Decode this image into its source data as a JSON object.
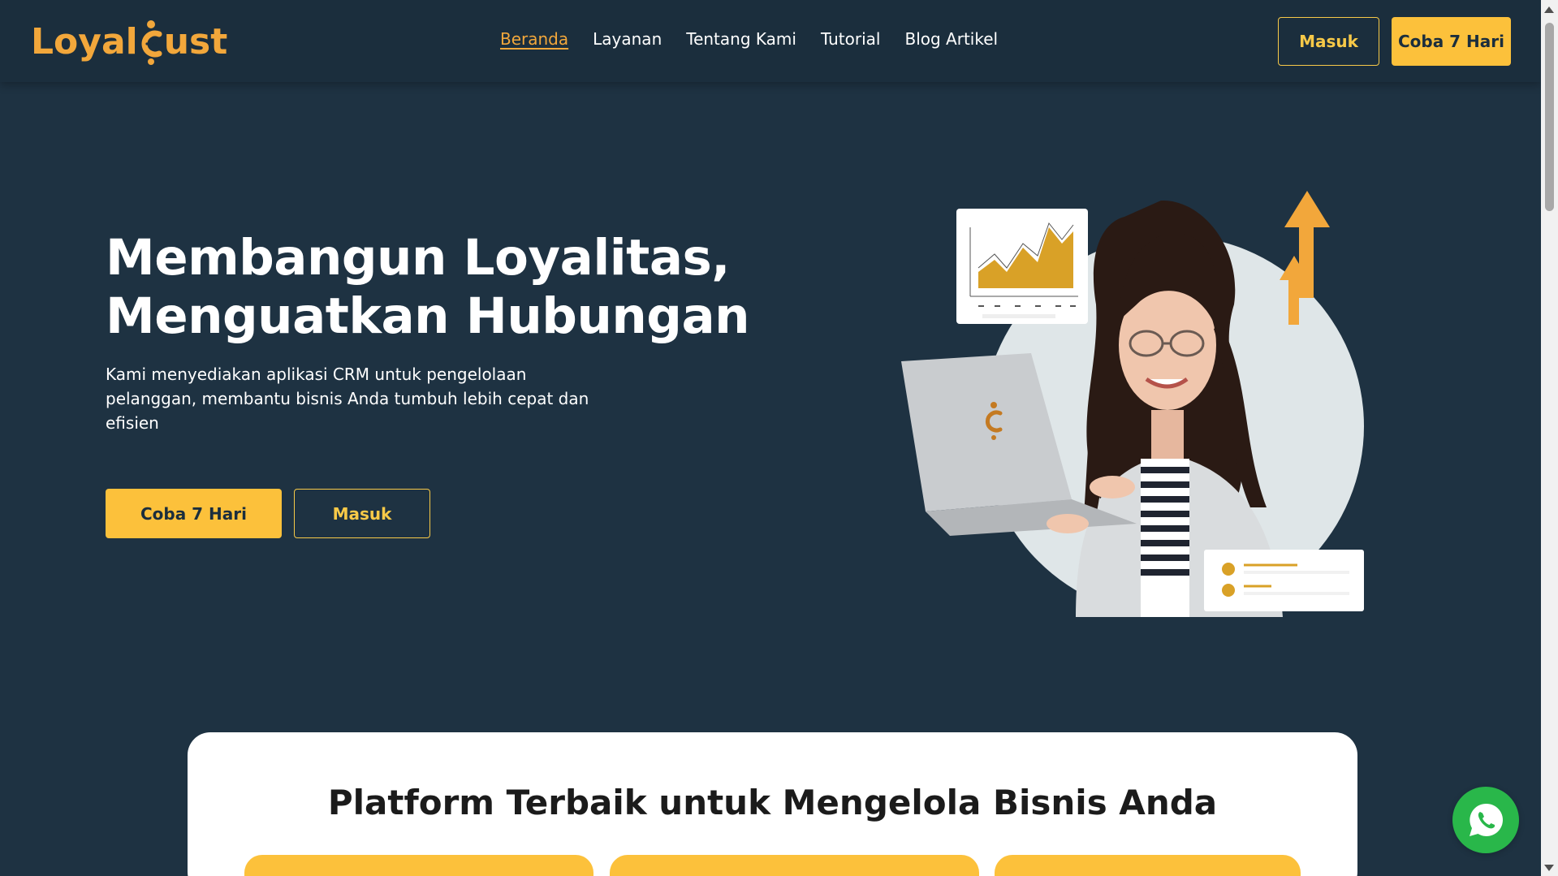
{
  "header": {
    "logo_text_left": "Loyal",
    "logo_text_right": "ust",
    "logo_icon": "loyalcust-c-person-icon",
    "nav": [
      {
        "label": "Beranda",
        "active": true
      },
      {
        "label": "Layanan",
        "active": false
      },
      {
        "label": "Tentang Kami",
        "active": false
      },
      {
        "label": "Tutorial",
        "active": false
      },
      {
        "label": "Blog Artikel",
        "active": false
      }
    ],
    "login_label": "Masuk",
    "trial_label": "Coba 7 Hari"
  },
  "hero": {
    "title_line1": "Membangun Loyalitas,",
    "title_line2": "Menguatkan Hubungan",
    "subtitle": "Kami menyediakan aplikasi CRM untuk pengelolaan pelanggan, membantu bisnis Anda tumbuh lebih cepat dan efisien",
    "trial_label": "Coba 7 Hari",
    "login_label": "Masuk",
    "illustration_icon": "woman-with-laptop-illustration"
  },
  "platform": {
    "title": "Platform Terbaik untuk Mengelola Bisnis Anda"
  },
  "floating": {
    "whatsapp_icon": "whatsapp-icon"
  },
  "colors": {
    "background": "#1e3242",
    "header": "#1b2e3d",
    "accent": "#fcc13b",
    "logo": "#f2a73b",
    "whatsapp": "#29b74a"
  }
}
